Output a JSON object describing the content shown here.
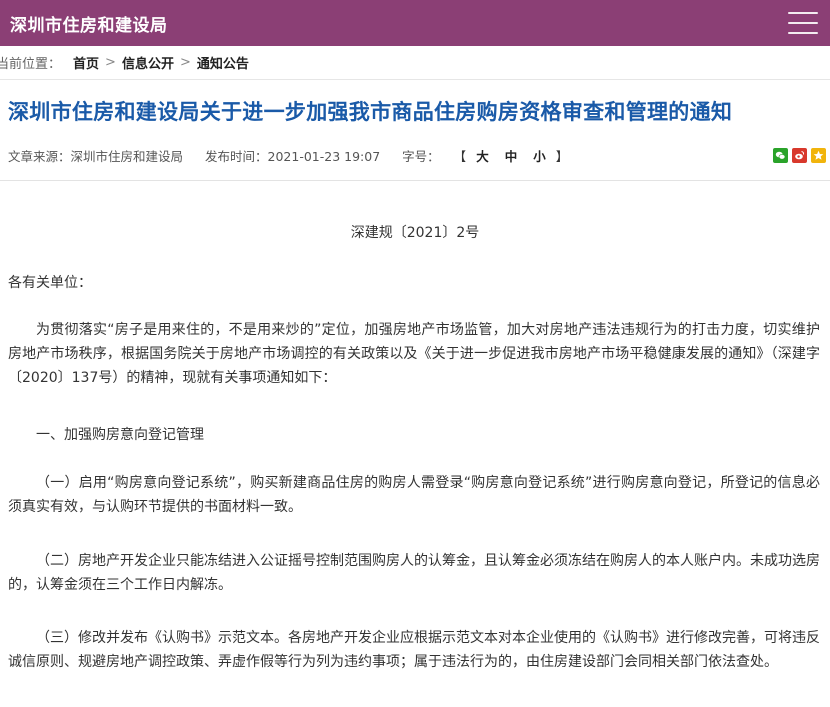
{
  "header": {
    "site_name": "深圳市住房和建设局"
  },
  "breadcrumb": {
    "label": "当前位置：",
    "items": [
      "首页",
      "信息公开",
      "通知公告"
    ],
    "separator": ">"
  },
  "article": {
    "title": "深圳市住房和建设局关于进一步加强我市商品住房购房资格审查和管理的通知",
    "source": "文章来源：深圳市住房和建设局",
    "published": "发布时间：2021-01-23 19:07",
    "font_size_label": "字号：",
    "font_bracket_open": "【",
    "font_bracket_close": "】",
    "font_sizes": [
      "大",
      "中",
      "小"
    ],
    "doc_number": "深建规〔2021〕2号",
    "salutation": "各有关单位：",
    "intro": "为贯彻落实“房子是用来住的，不是用来炒的”定位，加强房地产市场监管，加大对房地产违法违规行为的打击力度，切实维护房地产市场秩序，根据国务院关于房地产市场调控的有关政策以及《关于进一步促进我市房地产市场平稳健康发展的通知》（深建字〔2020〕137号）的精神，现就有关事项通知如下：",
    "section1": "一、加强购房意向登记管理",
    "item1": "（一）启用“购房意向登记系统”，购买新建商品住房的购房人需登录“购房意向登记系统”进行购房意向登记，所登记的信息必须真实有效，与认购环节提供的书面材料一致。",
    "item2": "（二）房地产开发企业只能冻结进入公证摇号控制范围购房人的认筹金，且认筹金必须冻结在购房人的本人账户内。未成功选房的，认筹金须在三个工作日内解冻。",
    "item3": "（三）修改并发布《认购书》示范文本。各房地产开发企业应根据示范文本对本企业使用的《认购书》进行修改完善，可将违反诚信原则、规避房地产调控政策、弄虚作假等行为列为违约事项；属于违法行为的，由住房建设部门会同相关部门依法查处。"
  },
  "colors": {
    "header_bg": "#8b3f75",
    "title": "#1a5aa8"
  }
}
